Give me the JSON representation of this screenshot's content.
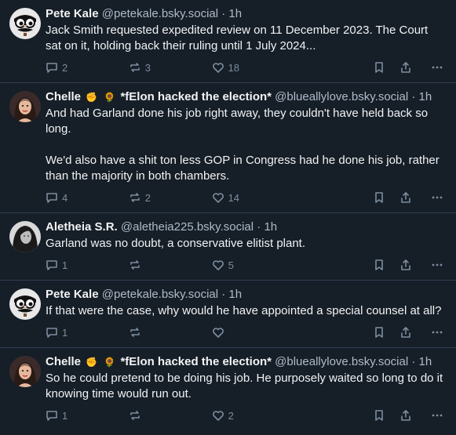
{
  "posts": [
    {
      "name": "Pete Kale",
      "handle": "@petekale.bsky.social",
      "time": "1h",
      "text": "Jack Smith requested expedited review on 11 December 2023. The Court sat on it, holding back their ruling until 1 July 2024...",
      "replies": "2",
      "reposts": "3",
      "likes": "18",
      "avatar": "groucho-glasses-avatar"
    },
    {
      "name": "Chelle",
      "emoji1": "✊",
      "emoji2": "🌻",
      "name_suffix": "*fElon hacked the election*",
      "handle": "@blueallylove.bsky.social",
      "time": "1h",
      "text": "And had Garland done his job right away, they couldn't have held back so long.\n\nWe'd also have a shit ton less GOP in Congress had he done his job, rather than the majority in both chambers.",
      "replies": "4",
      "reposts": "2",
      "likes": "14",
      "avatar": "woman-portrait-avatar"
    },
    {
      "name": "Aletheia S.R.",
      "handle": "@aletheia225.bsky.social",
      "time": "1h",
      "text": "Garland was no doubt, a conservative elitist plant.",
      "replies": "1",
      "reposts": "",
      "likes": "5",
      "avatar": "bw-portrait-avatar"
    },
    {
      "name": "Pete Kale",
      "handle": "@petekale.bsky.social",
      "time": "1h",
      "text": "If that were the case, why would he have appointed a special counsel at all?",
      "replies": "1",
      "reposts": "",
      "likes": "",
      "avatar": "groucho-glasses-avatar"
    },
    {
      "name": "Chelle",
      "emoji1": "✊",
      "emoji2": "🌻",
      "name_suffix": "*fElon hacked the election*",
      "handle": "@blueallylove.bsky.social",
      "time": "1h",
      "text": "So he could pretend to be doing his job. He purposely waited so long to do it knowing time would run out.",
      "replies": "1",
      "reposts": "",
      "likes": "2",
      "avatar": "woman-portrait-avatar"
    }
  ],
  "separator": "·",
  "colors": {
    "background": "#161e27",
    "border": "#2e4052",
    "text": "#f1f3f5",
    "muted": "#7b8d9f"
  }
}
